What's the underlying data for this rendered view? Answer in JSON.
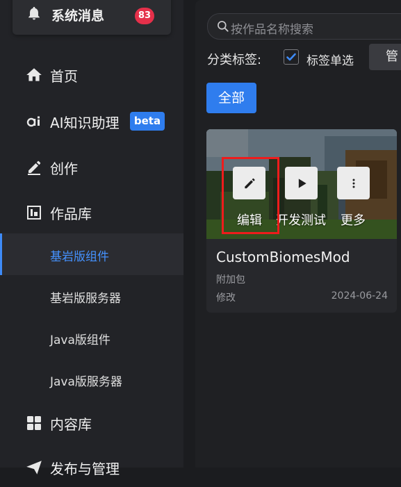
{
  "notification": {
    "title": "系统消息",
    "count": "83"
  },
  "nav": {
    "home": "首页",
    "ai": "AI知识助理",
    "ai_badge": "beta",
    "create": "创作",
    "library": "作品库",
    "library_children": [
      "基岩版组件",
      "基岩版服务器",
      "Java版组件",
      "Java版服务器"
    ],
    "content": "内容库",
    "publish": "发布与管理"
  },
  "search": {
    "placeholder": "按作品名称搜索"
  },
  "filter": {
    "label": "分类标签:",
    "single_select_label": "标签单选",
    "single_select_checked": true,
    "manage_label": "管"
  },
  "tags": {
    "all": "全部"
  },
  "project_card": {
    "title": "CustomBiomesMod",
    "type": "附加包",
    "status": "修改",
    "date": "2024-06-24",
    "actions": {
      "edit": "编辑",
      "test": "开发测试",
      "more": "更多"
    }
  },
  "colors": {
    "accent": "#2f7dee",
    "active_text": "#4592ff",
    "badge": "#e5304a",
    "highlight": "#ee1c1c"
  },
  "icons": [
    "bell-icon",
    "home-icon",
    "ai-icon",
    "pencil-icon",
    "library-icon",
    "grid-icon",
    "send-icon",
    "search-icon",
    "check-icon",
    "edit-icon",
    "play-icon",
    "more-icon"
  ]
}
